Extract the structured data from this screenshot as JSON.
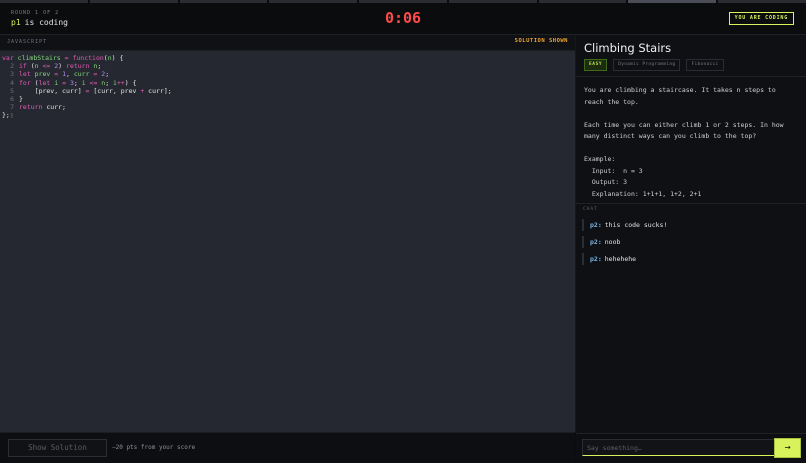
{
  "header": {
    "round": "ROUND 1 OF 2",
    "player": "p1",
    "status": "is coding",
    "timer": "0:06",
    "badge": "YOU ARE CODING"
  },
  "editor": {
    "language": "JAVASCRIPT",
    "solution_status": "SOLUTION SHOWN"
  },
  "footer": {
    "show_solution_label": "Show Solution",
    "penalty_text": "−20 pts from your score"
  },
  "problem": {
    "title": "Climbing Stairs",
    "difficulty": "EASY",
    "tags": [
      "Dynamic Programming",
      "Fibonacci"
    ],
    "description_1": "You are climbing a staircase. It takes n steps to reach the top.",
    "description_2": "Each time you can either climb 1 or 2 steps. In how many distinct ways can you climb to the top?",
    "example_label": "Example:",
    "example_input": "  Input:  n = 3",
    "example_output": "  Output: 3",
    "example_explanation": "  Explanation: 1+1+1, 1+2, 2+1"
  },
  "chat": {
    "label": "CHAT",
    "messages": [
      {
        "user": "p2:",
        "text": "this code sucks!"
      },
      {
        "user": "p2:",
        "text": "noob"
      },
      {
        "user": "p2:",
        "text": "hehehehe"
      }
    ],
    "input_placeholder": "Say something…",
    "send_icon": "→"
  },
  "colors": {
    "accent": "#d7f25b",
    "timer": "#ff4a4a",
    "solution_shown": "#f1a532",
    "chat_user": "#77b7ea"
  }
}
